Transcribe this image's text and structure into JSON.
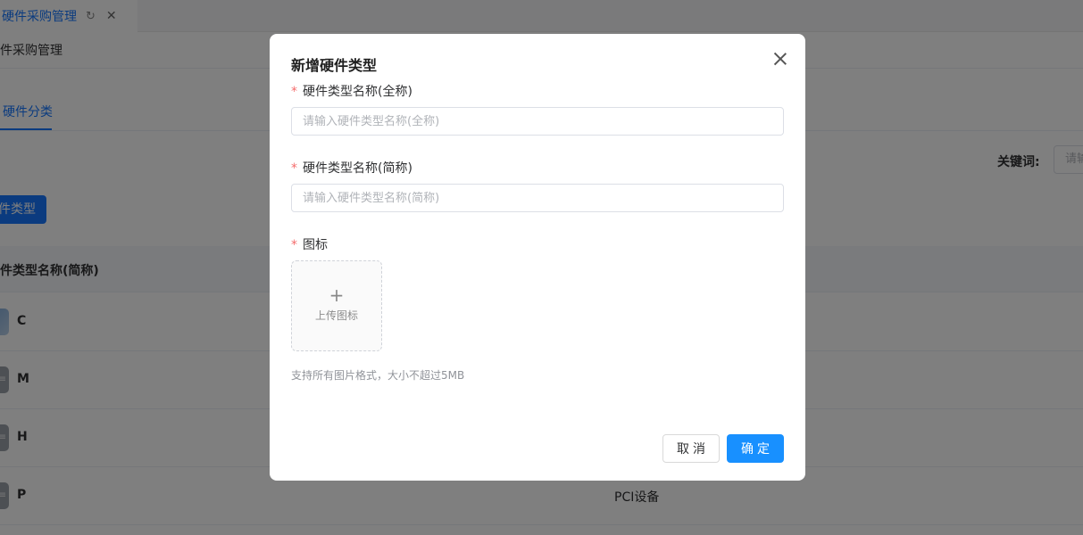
{
  "tabs": {
    "active_title": "硬件采购管理",
    "refresh_icon": "refresh-icon",
    "close_icon": "close-icon"
  },
  "breadcrumb": "件采购管理",
  "subtab": "硬件分类",
  "search": {
    "label": "关键词:",
    "placeholder": "请输"
  },
  "add_button": "件类型",
  "table": {
    "header": "件类型名称(简称)",
    "rows": [
      {
        "abbr": "C",
        "extra": ""
      },
      {
        "abbr": "M",
        "extra": ""
      },
      {
        "abbr": "H",
        "extra": ""
      },
      {
        "abbr": "P",
        "extra": "PCI设备"
      }
    ]
  },
  "modal": {
    "title": "新增硬件类型",
    "full_name": {
      "label": "硬件类型名称(全称)",
      "placeholder": "请输入硬件类型名称(全称)",
      "value": ""
    },
    "short_name": {
      "label": "硬件类型名称(简称)",
      "placeholder": "请输入硬件类型名称(简称)",
      "value": ""
    },
    "icon_field": {
      "label": "图标",
      "upload_text": "上传图标",
      "upload_symbol": "+"
    },
    "hint": "支持所有图片格式，大小不超过5MB",
    "required_mark": "*",
    "cancel_label": "取消",
    "ok_label": "确定"
  },
  "colors": {
    "primary": "#1677ff",
    "required": "#f56c6c",
    "ok_button": "#1890ff"
  }
}
